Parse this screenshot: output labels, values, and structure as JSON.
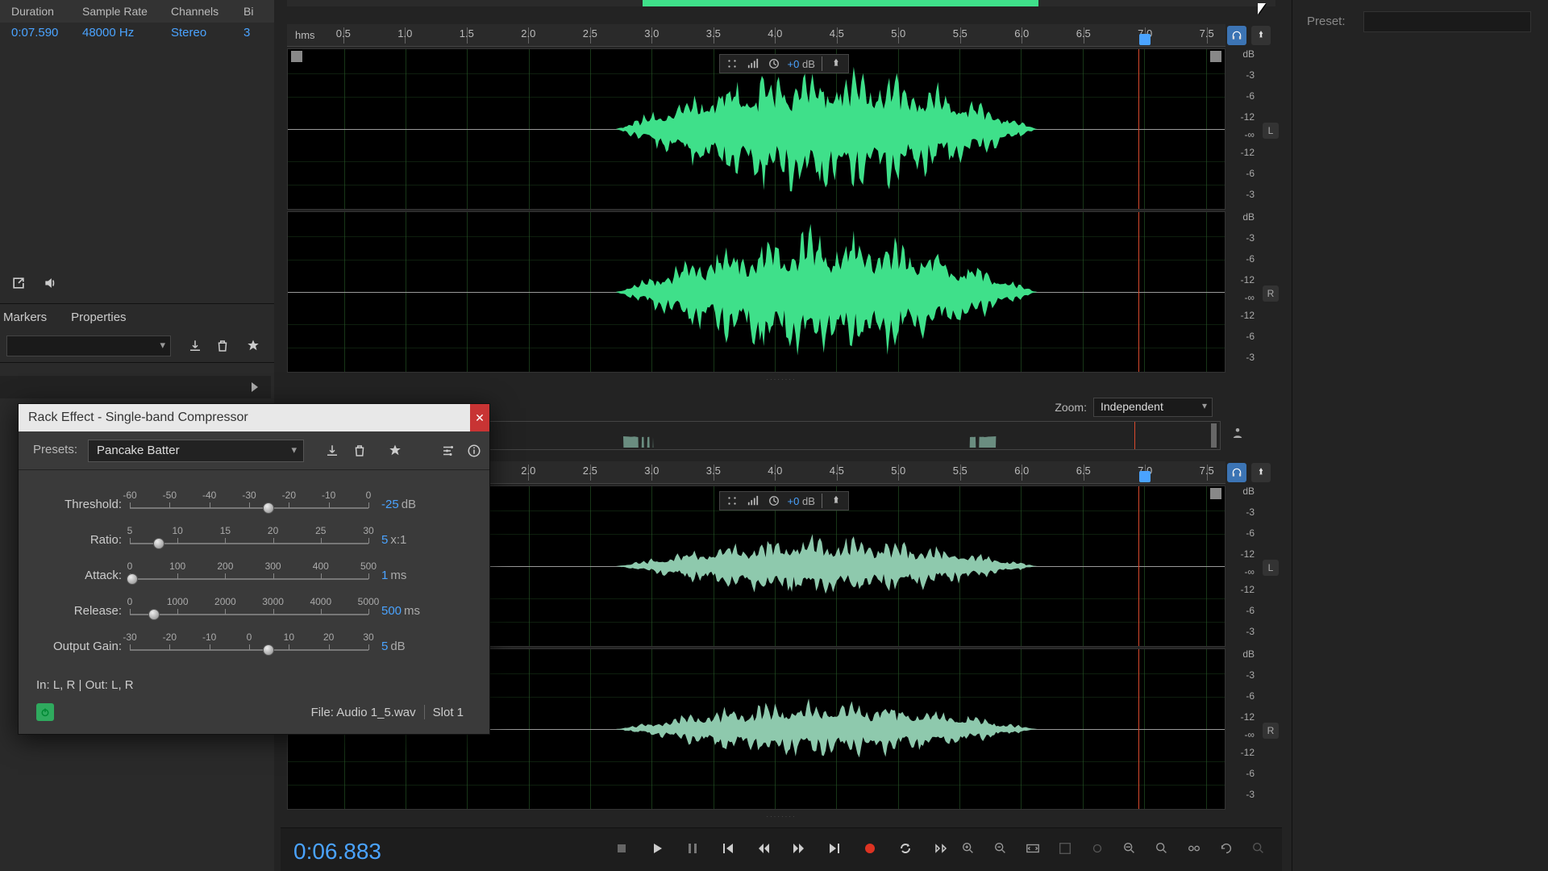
{
  "file_table": {
    "headers": {
      "duration": "Duration",
      "sample_rate": "Sample Rate",
      "channels": "Channels",
      "bit": "Bi"
    },
    "row": {
      "duration": "0:07.590",
      "sample_rate": "48000 Hz",
      "channels": "Stereo",
      "bit": "3"
    }
  },
  "panel_tabs": {
    "markers": "Markers",
    "properties": "Properties"
  },
  "zoom": {
    "label": "Zoom:",
    "value": "Independent"
  },
  "ruler": {
    "unit": "hms",
    "ticks": [
      "0.5",
      "1.0",
      "1.5",
      "2.0",
      "2.5",
      "3.0",
      "3.5",
      "4.0",
      "4.5",
      "5.0",
      "5.5",
      "6.0",
      "6.5",
      "7.0",
      "7.5"
    ],
    "playhead_at": "7.0"
  },
  "db_scale": [
    "dB",
    "-3",
    "-6",
    "-12",
    "-∞",
    "-12",
    "-6",
    "-3"
  ],
  "channel_badges": {
    "left": "L",
    "right": "R"
  },
  "gain_widget": {
    "value": "+0",
    "unit": "dB"
  },
  "right_panel": {
    "preset_label": "Preset:"
  },
  "transport": {
    "timecode": "0:06.883"
  },
  "dialog": {
    "title": "Rack Effect - Single-band Compressor",
    "presets_label": "Presets:",
    "preset_value": "Pancake Batter",
    "io_text": "In: L, R | Out: L, R",
    "file_label": "File: Audio 1_5.wav",
    "slot_label": "Slot 1",
    "params": [
      {
        "name": "Threshold:",
        "ticks": [
          "-60",
          "-50",
          "-40",
          "-30",
          "-20",
          "-10",
          "0"
        ],
        "knob_pct": 58,
        "value": "-25",
        "unit": "dB"
      },
      {
        "name": "Ratio:",
        "ticks": [
          "5",
          "10",
          "15",
          "20",
          "25",
          "30"
        ],
        "knob_pct": 12,
        "value": "5",
        "unit": "x:1"
      },
      {
        "name": "Attack:",
        "ticks": [
          "0",
          "100",
          "200",
          "300",
          "400",
          "500"
        ],
        "knob_pct": 1,
        "value": "1",
        "unit": "ms"
      },
      {
        "name": "Release:",
        "ticks": [
          "0",
          "1000",
          "2000",
          "3000",
          "4000",
          "5000"
        ],
        "knob_pct": 10,
        "value": "500",
        "unit": "ms"
      },
      {
        "name": "Output Gain:",
        "ticks": [
          "-30",
          "-20",
          "-10",
          "0",
          "10",
          "20",
          "30"
        ],
        "knob_pct": 58,
        "value": "5",
        "unit": "dB"
      }
    ]
  }
}
